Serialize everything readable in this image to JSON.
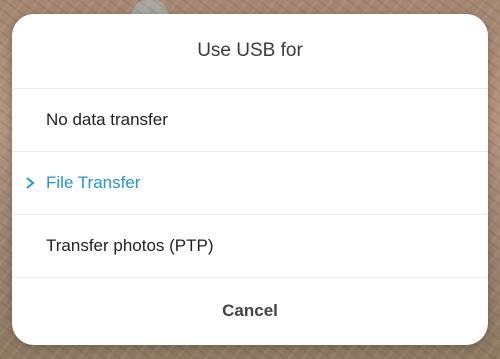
{
  "dialog": {
    "title": "Use USB for",
    "options": [
      {
        "label": "No data transfer",
        "selected": false
      },
      {
        "label": "File Transfer",
        "selected": true
      },
      {
        "label": "Transfer photos (PTP)",
        "selected": false
      }
    ],
    "cancel_label": "Cancel",
    "selected_icon": "chevron-right-icon",
    "accent_color": "#2196d9"
  }
}
